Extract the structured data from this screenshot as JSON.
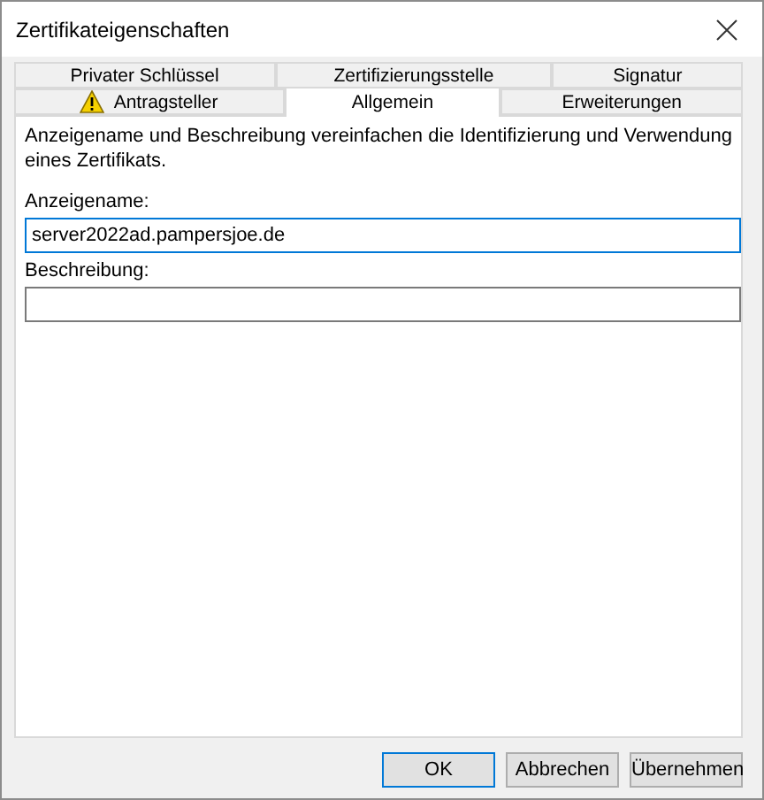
{
  "window": {
    "title": "Zertifikateigenschaften"
  },
  "tab_rows": [
    [
      {
        "label": "Privater Schlüssel",
        "selected": false,
        "warning": false
      },
      {
        "label": "Zertifizierungsstelle",
        "selected": false,
        "warning": false
      },
      {
        "label": "Signatur",
        "selected": false,
        "warning": false
      }
    ],
    [
      {
        "label": "Antragsteller",
        "selected": false,
        "warning": true
      },
      {
        "label": "Allgemein",
        "selected": true,
        "warning": false
      },
      {
        "label": "Erweiterungen",
        "selected": false,
        "warning": false
      }
    ]
  ],
  "description": "Anzeigename und Beschreibung vereinfachen die Identifizierung und Verwendung eines Zertifikats.",
  "fields": [
    {
      "label": "Anzeigename:",
      "value": "server2022ad.pampersjoe.de",
      "focused": true
    },
    {
      "label": "Beschreibung:",
      "focused": false
    }
  ],
  "buttons": [
    {
      "label": "OK",
      "default": true
    },
    {
      "label": "Abbrechen",
      "default": false
    },
    {
      "label": "Übernehmen",
      "default": false
    }
  ]
}
